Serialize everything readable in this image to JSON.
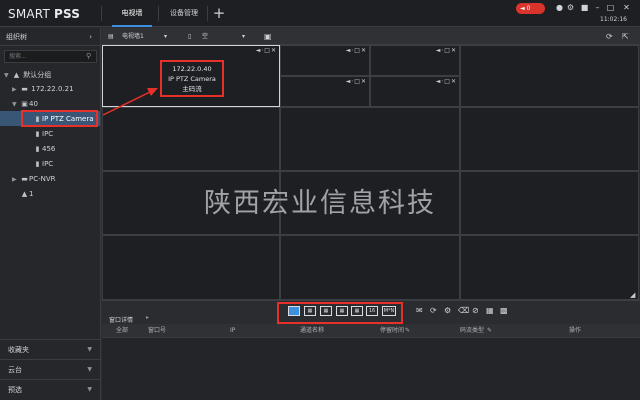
{
  "app": {
    "logo_light": "SMART ",
    "logo_bold": "PSS",
    "tabs": [
      {
        "label": "电视墙",
        "active": true
      },
      {
        "label": "设备管理",
        "active": false
      }
    ],
    "alarm_count": "0",
    "clock": "11:02:16"
  },
  "sidebar": {
    "title": "组织树",
    "search_placeholder": "搜索...",
    "tree": [
      {
        "label": "默认分组",
        "icon": "group-icon",
        "expanded": true
      },
      {
        "label": "172.22.0.21",
        "icon": "nvr-icon",
        "expanded": false
      },
      {
        "label": "40",
        "icon": "folder-icon",
        "expanded": true
      },
      {
        "label": "IP PTZ Camera",
        "icon": "camera-icon",
        "selected": true
      },
      {
        "label": "IPC",
        "icon": "camera-icon"
      },
      {
        "label": "456",
        "icon": "camera-icon"
      },
      {
        "label": "IPC",
        "icon": "camera-icon"
      },
      {
        "label": "PC-NVR",
        "icon": "nvr-icon",
        "expanded": false
      },
      {
        "label": "1",
        "icon": "group-icon"
      }
    ],
    "sections": [
      {
        "label": "收藏夹"
      },
      {
        "label": "云台"
      },
      {
        "label": "预选"
      }
    ]
  },
  "toolbar": {
    "wall_label": "电视墙1",
    "mode_label": "空"
  },
  "cell": {
    "ip": "172.22.0.40",
    "name": "IP PTZ Camera",
    "stream": "主码流"
  },
  "watermark": "陕西宏业信息科技",
  "bottom": {
    "detail_tab": "窗口详情",
    "layout_buttons": [
      "",
      "",
      "",
      "",
      "",
      "16",
      "M*N"
    ],
    "columns": [
      "全部",
      "窗口号",
      "IP",
      "通道名称",
      "停留时间",
      "码流类型",
      "操作"
    ]
  },
  "colors": {
    "accent": "#3e8fe0",
    "highlight": "#e8302a",
    "alarm": "#d9342b"
  }
}
